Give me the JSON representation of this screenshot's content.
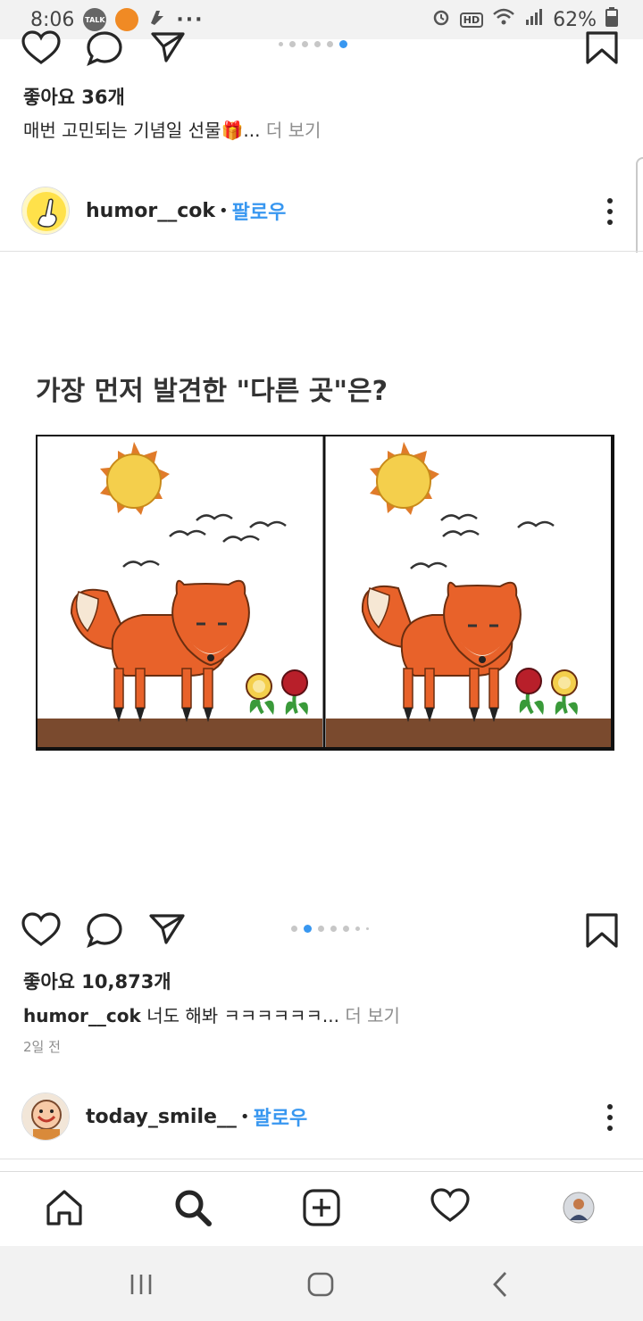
{
  "status_bar": {
    "time": "8:06",
    "talk_badge": "TALK",
    "more_dots": "···",
    "hd_label": "HD",
    "battery": "62%"
  },
  "prev_post": {
    "likes": "좋아요 36개",
    "caption_text": "매번 고민되는 기념일 선물🎁...",
    "more": "더 보기"
  },
  "post": {
    "username": "humor__cok",
    "follow": "팔로우",
    "image_title": "가장 먼저 발견한 \"다른 곳\"은?",
    "likes": "좋아요 10,873개",
    "caption_user": "humor__cok",
    "caption_text": "너도 해봐 ㅋㅋㅋㅋㅋㅋ...",
    "more": "더 보기",
    "time_ago": "2일 전"
  },
  "next_post": {
    "username": "today_smile__",
    "follow": "팔로우"
  },
  "icons": {
    "like": "heart-icon",
    "comment": "comment-bubble-icon",
    "share": "paper-plane-icon",
    "save": "bookmark-icon",
    "options": "more-vertical-icon",
    "nav_home": "home-icon",
    "nav_search": "search-icon",
    "nav_add": "add-post-icon",
    "nav_activity": "heart-icon",
    "nav_profile": "profile-avatar",
    "sys_recents": "recent-apps-icon",
    "sys_home": "home-button-icon",
    "sys_back": "back-icon"
  },
  "colors": {
    "accent_blue": "#3897f0",
    "fox_orange": "#e8622a",
    "sun_yellow": "#f4cf4c",
    "ground_brown": "#7a4a2e"
  }
}
